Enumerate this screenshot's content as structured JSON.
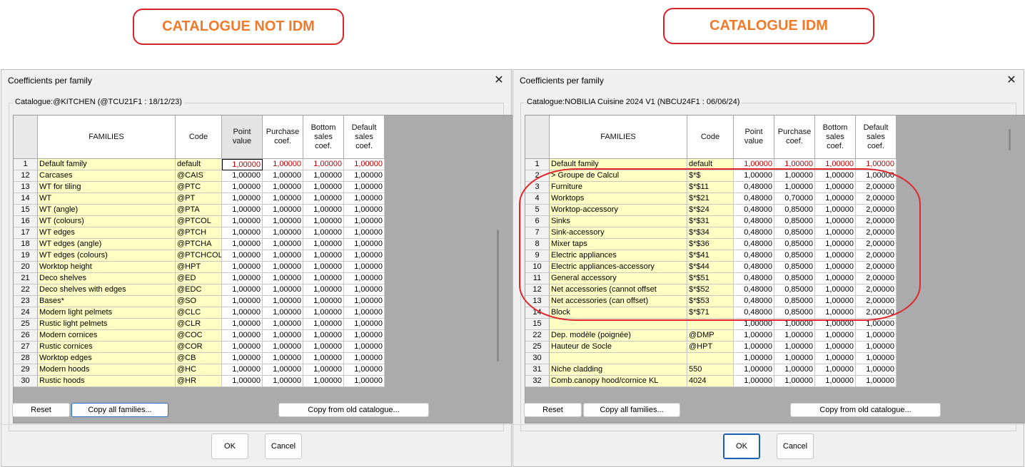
{
  "callouts": {
    "left": "CATALOGUE NOT IDM",
    "right": "CATALOGUE IDM"
  },
  "dialogs": [
    {
      "title": "Coefficients per family",
      "catalogue_label": "Catalogue:@KITCHEN (@TCU21F1 : 18/12/23)",
      "headers": [
        "FAMILIES",
        "Code",
        "Point\nvalue",
        "Purchase\ncoef.",
        "Bottom\nsales\ncoef.",
        "Default\nsales\ncoef."
      ],
      "rows": [
        [
          "1",
          "Default family",
          "default",
          "1,00000",
          "1,00000",
          "1,00000",
          "1,00000"
        ],
        [
          "12",
          "Carcases",
          "@CAIS",
          "1,00000",
          "1,00000",
          "1,00000",
          "1,00000"
        ],
        [
          "13",
          "WT for tiling",
          "@PTC",
          "1,00000",
          "1,00000",
          "1,00000",
          "1,00000"
        ],
        [
          "14",
          "WT",
          "@PT",
          "1,00000",
          "1,00000",
          "1,00000",
          "1,00000"
        ],
        [
          "15",
          "WT (angle)",
          "@PTA",
          "1,00000",
          "1,00000",
          "1,00000",
          "1,00000"
        ],
        [
          "16",
          "WT (colours)",
          "@PTCOL",
          "1,00000",
          "1,00000",
          "1,00000",
          "1,00000"
        ],
        [
          "17",
          "WT edges",
          "@PTCH",
          "1,00000",
          "1,00000",
          "1,00000",
          "1,00000"
        ],
        [
          "18",
          "WT edges (angle)",
          "@PTCHA",
          "1,00000",
          "1,00000",
          "1,00000",
          "1,00000"
        ],
        [
          "19",
          "WT edges (colours)",
          "@PTCHCOL",
          "1,00000",
          "1,00000",
          "1,00000",
          "1,00000"
        ],
        [
          "20",
          "Worktop height",
          "@HPT",
          "1,00000",
          "1,00000",
          "1,00000",
          "1,00000"
        ],
        [
          "21",
          "Deco shelves",
          "@ED",
          "1,00000",
          "1,00000",
          "1,00000",
          "1,00000"
        ],
        [
          "22",
          "Deco shelves with edges",
          "@EDC",
          "1,00000",
          "1,00000",
          "1,00000",
          "1,00000"
        ],
        [
          "23",
          "Bases*",
          "@SO",
          "1,00000",
          "1,00000",
          "1,00000",
          "1,00000"
        ],
        [
          "24",
          "Modern light pelmets",
          "@CLC",
          "1,00000",
          "1,00000",
          "1,00000",
          "1,00000"
        ],
        [
          "25",
          "Rustic light pelmets",
          "@CLR",
          "1,00000",
          "1,00000",
          "1,00000",
          "1,00000"
        ],
        [
          "26",
          "Modern cornices",
          "@COC",
          "1,00000",
          "1,00000",
          "1,00000",
          "1,00000"
        ],
        [
          "27",
          "Rustic cornices",
          "@COR",
          "1,00000",
          "1,00000",
          "1,00000",
          "1,00000"
        ],
        [
          "28",
          "Worktop edges",
          "@CB",
          "1,00000",
          "1,00000",
          "1,00000",
          "1,00000"
        ],
        [
          "29",
          "Modern hoods",
          "@HC",
          "1,00000",
          "1,00000",
          "1,00000",
          "1,00000"
        ],
        [
          "30",
          "Rustic hoods",
          "@HR",
          "1,00000",
          "1,00000",
          "1,00000",
          "1,00000"
        ]
      ],
      "buttons": {
        "reset": "Reset",
        "copy_all": "Copy all families...",
        "copy_old": "Copy from old catalogue...",
        "ok": "OK",
        "cancel": "Cancel"
      }
    },
    {
      "title": "Coefficients per family",
      "catalogue_label": "Catalogue:NOBILIA Cuisine 2024 V1 (NBCU24F1 : 06/06/24)",
      "headers": [
        "FAMILIES",
        "Code",
        "Point\nvalue",
        "Purchase\ncoef.",
        "Bottom\nsales\ncoef.",
        "Default\nsales\ncoef."
      ],
      "rows": [
        [
          "1",
          "Default family",
          "default",
          "1,00000",
          "1,00000",
          "1,00000",
          "1,00000"
        ],
        [
          "2",
          "> Groupe de Calcul",
          "$*$",
          "1,00000",
          "1,00000",
          "1,00000",
          "1,00000"
        ],
        [
          "3",
          "Furniture",
          "$*$11",
          "0,48000",
          "1,00000",
          "1,00000",
          "2,00000"
        ],
        [
          "4",
          "Worktops",
          "$*$21",
          "0,48000",
          "0,70000",
          "1,00000",
          "2,00000"
        ],
        [
          "5",
          "Worktop-accessory",
          "$*$24",
          "0,48000",
          "0,85000",
          "1,00000",
          "2,00000"
        ],
        [
          "6",
          "Sinks",
          "$*$31",
          "0,48000",
          "0,85000",
          "1,00000",
          "2,00000"
        ],
        [
          "7",
          "Sink-accessory",
          "$*$34",
          "0,48000",
          "0,85000",
          "1,00000",
          "2,00000"
        ],
        [
          "8",
          "Mixer taps",
          "$*$36",
          "0,48000",
          "0,85000",
          "1,00000",
          "2,00000"
        ],
        [
          "9",
          "Electric appliances",
          "$*$41",
          "0,48000",
          "0,85000",
          "1,00000",
          "2,00000"
        ],
        [
          "10",
          "Electric appliances-accessory",
          "$*$44",
          "0,48000",
          "0,85000",
          "1,00000",
          "2,00000"
        ],
        [
          "11",
          "General accessory",
          "$*$51",
          "0,48000",
          "0,85000",
          "1,00000",
          "2,00000"
        ],
        [
          "12",
          "Net accessories (cannot offset",
          "$*$52",
          "0,48000",
          "0,85000",
          "1,00000",
          "2,00000"
        ],
        [
          "13",
          "Net accessories (can offset)",
          "$*$53",
          "0,48000",
          "0,85000",
          "1,00000",
          "2,00000"
        ],
        [
          "14",
          "Block",
          "$*$71",
          "0,48000",
          "0,85000",
          "1,00000",
          "2,00000"
        ],
        [
          "15",
          "",
          "",
          "1,00000",
          "1,00000",
          "1,00000",
          "1,00000"
        ],
        [
          "22",
          "Dep. modèle (poignée)",
          "@DMP",
          "1,00000",
          "1,00000",
          "1,00000",
          "1,00000"
        ],
        [
          "25",
          "Hauteur de Socle",
          "@HPT",
          "1,00000",
          "1,00000",
          "1,00000",
          "1,00000"
        ],
        [
          "30",
          "",
          "",
          "1,00000",
          "1,00000",
          "1,00000",
          "1,00000"
        ],
        [
          "31",
          "Niche cladding",
          "550",
          "1,00000",
          "1,00000",
          "1,00000",
          "1,00000"
        ],
        [
          "32",
          "Comb.canopy hood/cornice KL",
          "4024",
          "1,00000",
          "1,00000",
          "1,00000",
          "1,00000"
        ]
      ],
      "buttons": {
        "reset": "Reset",
        "copy_all": "Copy all families...",
        "copy_old": "Copy from old catalogue...",
        "ok": "OK",
        "cancel": "Cancel"
      }
    }
  ],
  "colors": {
    "callout_text": "#f07a2a",
    "callout_border": "#d9232a",
    "family_cell": "#ffffc4",
    "default_row_value": "#c00000",
    "grid_background": "#ababab"
  }
}
